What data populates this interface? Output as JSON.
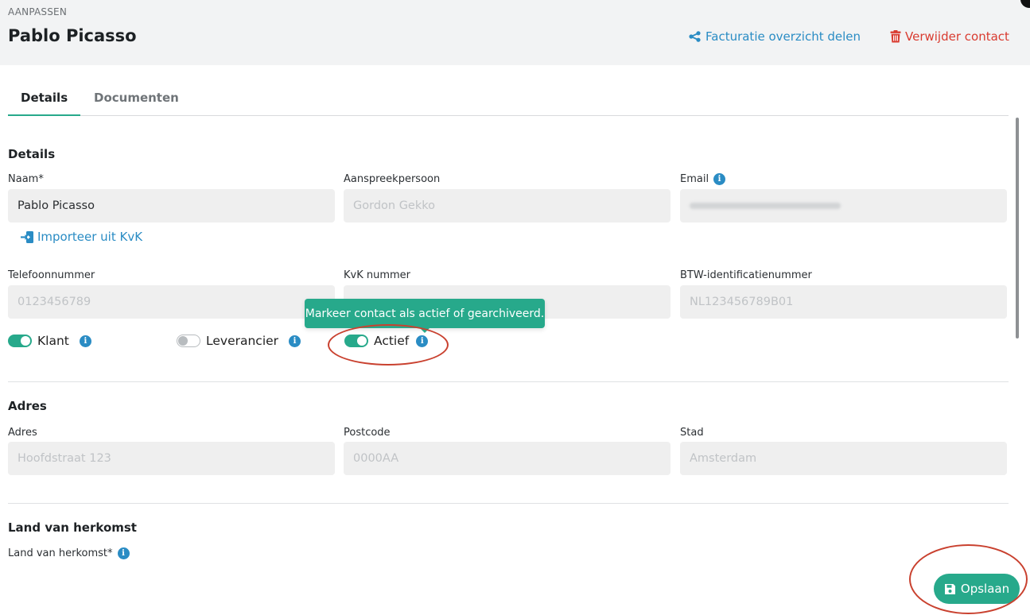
{
  "header": {
    "eyebrow": "AANPASSEN",
    "title": "Pablo Picasso",
    "share_label": "Facturatie overzicht delen",
    "delete_label": "Verwijder contact"
  },
  "tabs": [
    {
      "label": "Details",
      "active": true
    },
    {
      "label": "Documenten",
      "active": false
    }
  ],
  "details": {
    "section_title": "Details",
    "naam": {
      "label": "Naam*",
      "value": "Pablo Picasso"
    },
    "aanspreekpersoon": {
      "label": "Aanspreekpersoon",
      "placeholder": "Gordon Gekko"
    },
    "email": {
      "label": "Email"
    },
    "import_link": "Importeer uit KvK",
    "telefoon": {
      "label": "Telefoonnummer",
      "placeholder": "0123456789"
    },
    "kvk": {
      "label": "KvK nummer"
    },
    "btw": {
      "label": "BTW-identificatienummer",
      "placeholder": "NL123456789B01"
    },
    "toggles": {
      "klant": {
        "label": "Klant",
        "on": true
      },
      "leverancier": {
        "label": "Leverancier",
        "on": false
      },
      "actief": {
        "label": "Actief",
        "on": true
      }
    },
    "tooltip": "Markeer contact als actief of gearchiveerd."
  },
  "adres": {
    "section_title": "Adres",
    "adres": {
      "label": "Adres",
      "placeholder": "Hoofdstraat 123"
    },
    "postcode": {
      "label": "Postcode",
      "placeholder": "0000AA"
    },
    "stad": {
      "label": "Stad",
      "placeholder": "Amsterdam"
    }
  },
  "land": {
    "section_title": "Land van herkomst",
    "label": "Land van herkomst*"
  },
  "save_label": "Opslaan",
  "colors": {
    "accent": "#27a98b",
    "link": "#2a8cc4",
    "danger": "#d93b30",
    "annotation": "#c9412f"
  }
}
